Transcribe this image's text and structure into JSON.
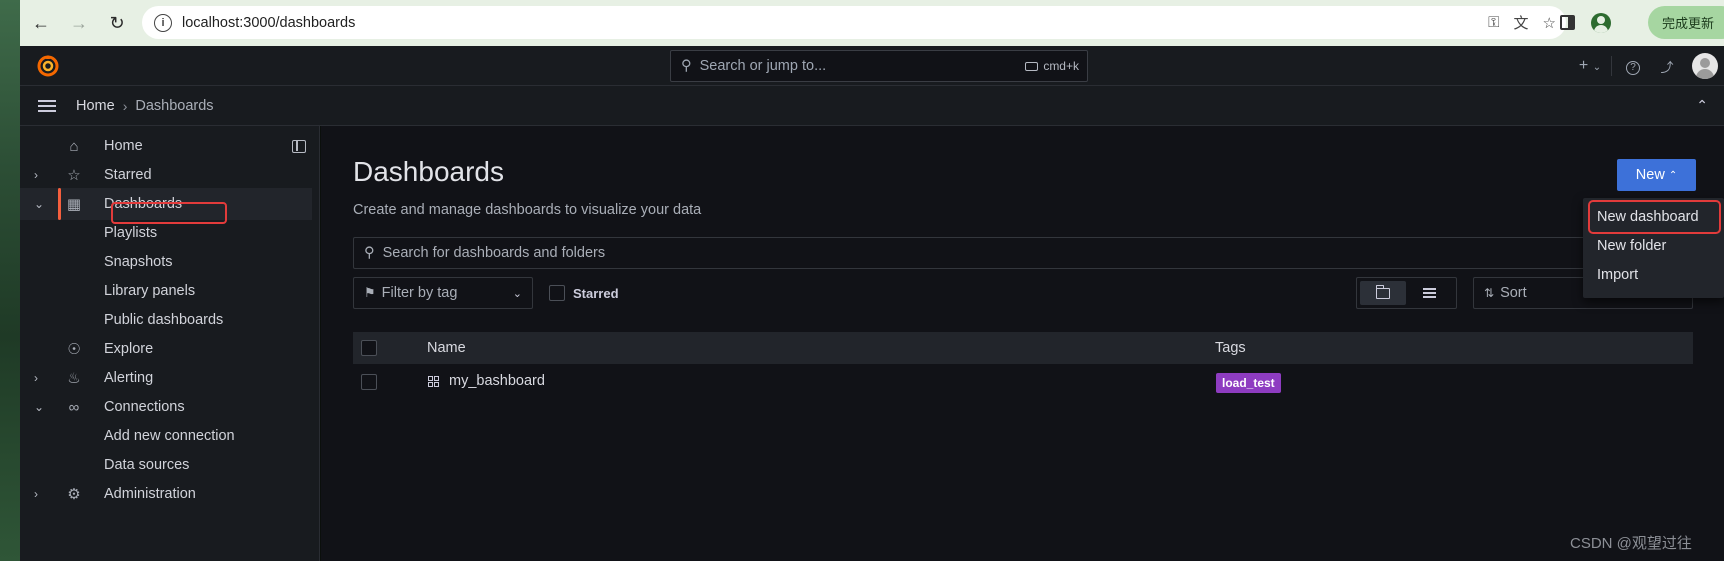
{
  "browser": {
    "url": "localhost:3000/dashboards",
    "update_button": "完成更新"
  },
  "topbar": {
    "search_placeholder": "Search or jump to...",
    "shortcut": "cmd+k",
    "plus_icon": "+",
    "help_icon": "?",
    "feed_icon": "rss"
  },
  "breadcrumb": {
    "home": "Home",
    "separator": "›",
    "current": "Dashboards"
  },
  "sidebar": {
    "items": [
      {
        "label": "Home",
        "icon": "home-icon"
      },
      {
        "label": "Starred",
        "icon": "star-icon"
      },
      {
        "label": "Dashboards",
        "icon": "apps-icon"
      },
      {
        "label": "Playlists"
      },
      {
        "label": "Snapshots"
      },
      {
        "label": "Library panels"
      },
      {
        "label": "Public dashboards"
      },
      {
        "label": "Explore",
        "icon": "compass-icon"
      },
      {
        "label": "Alerting",
        "icon": "bell-icon"
      },
      {
        "label": "Connections",
        "icon": "connection-icon"
      },
      {
        "label": "Add new connection"
      },
      {
        "label": "Data sources"
      },
      {
        "label": "Administration",
        "icon": "cog-icon"
      }
    ]
  },
  "main": {
    "title": "Dashboards",
    "subtitle": "Create and manage dashboards to visualize your data",
    "new_button": "New",
    "search_placeholder": "Search for dashboards and folders",
    "filter_tag": "Filter by tag",
    "starred_label": "Starred",
    "sort_label": "Sort",
    "table": {
      "headers": [
        "Name",
        "Tags"
      ],
      "rows": [
        {
          "name": "my_bashboard",
          "tag": "load_test"
        }
      ]
    }
  },
  "new_menu": {
    "items": [
      "New dashboard",
      "New folder",
      "Import"
    ]
  },
  "watermark": "CSDN @观望过往",
  "colors": {
    "accent": "#3d71d9",
    "active_bar": "#f55f3e",
    "tag": "#8e3cc1",
    "highlight": "#e23b3b"
  }
}
